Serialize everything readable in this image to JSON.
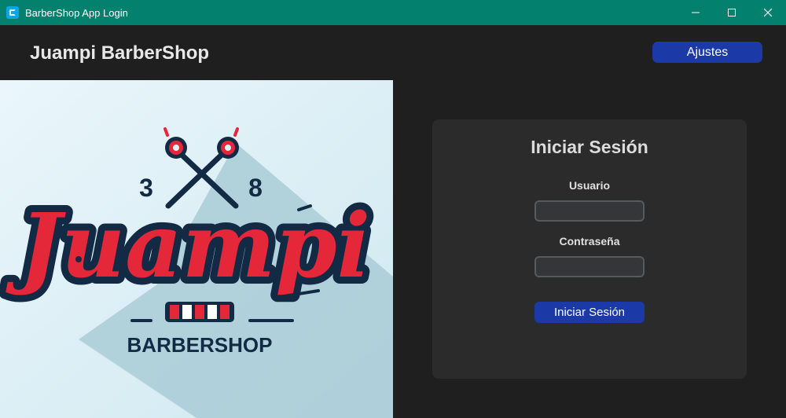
{
  "window": {
    "title": "BarberShop App Login",
    "controls": [
      "minimize-icon",
      "maximize-icon",
      "close-icon"
    ]
  },
  "header": {
    "title": "Juampi BarberShop",
    "settings_label": "Ajustes"
  },
  "logo": {
    "brand": "Juampi",
    "subtitle": "BARBERSHOP",
    "digit_left": "3",
    "digit_right": "8"
  },
  "login": {
    "title": "Iniciar Sesión",
    "username_label": "Usuario",
    "username_value": "",
    "password_label": "Contraseña",
    "password_value": "",
    "submit_label": "Iniciar Sesión"
  },
  "colors": {
    "titlebar": "#03806e",
    "background": "#1f1f1f",
    "card": "#2b2b2b",
    "accent_button": "#1b3aa7",
    "logo_red": "#e4283a",
    "logo_navy": "#132a44"
  }
}
